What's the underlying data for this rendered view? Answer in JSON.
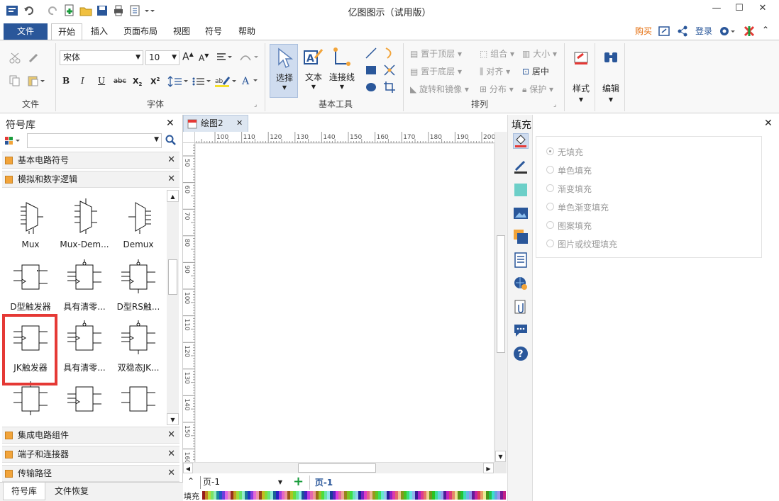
{
  "app": {
    "title": "亿图图示（试用版）"
  },
  "menu": {
    "file": "文件",
    "tabs": [
      "开始",
      "插入",
      "页面布局",
      "视图",
      "符号",
      "帮助"
    ],
    "right": {
      "buy": "购买",
      "login": "登录"
    }
  },
  "ribbon": {
    "font_name": "宋体",
    "font_size": "10",
    "groups": {
      "file": "文件",
      "font": "字体",
      "basic_tools": "基本工具",
      "arrange": "排列"
    },
    "tools": {
      "select": "选择",
      "text": "文本",
      "connector": "连接线"
    },
    "arrange": {
      "bring_front": "置于顶层",
      "send_back": "置于底层",
      "rotate_mirror": "旋转和镜像",
      "group": "组合",
      "align": "对齐",
      "distribute": "分布",
      "size": "大小",
      "center": "居中",
      "protect": "保护"
    },
    "style": "样式",
    "edit": "编辑"
  },
  "library": {
    "title": "符号库",
    "search_placeholder": "",
    "categories": {
      "basic_circuit": "基本电路符号",
      "analog_digital": "模拟和数字逻辑",
      "ic": "集成电路组件",
      "terminals": "端子和连接器",
      "transmission": "传输路径"
    },
    "shapes": [
      {
        "label": "Mux"
      },
      {
        "label": "Mux-Dem..."
      },
      {
        "label": "Demux"
      },
      {
        "label": "D型触发器"
      },
      {
        "label": "具有清零..."
      },
      {
        "label": "D型RS触..."
      },
      {
        "label": "JK触发器"
      },
      {
        "label": "具有清零..."
      },
      {
        "label": "双稳态JK..."
      }
    ],
    "bottom_tabs": {
      "library": "符号库",
      "recovery": "文件恢复"
    }
  },
  "document": {
    "tab": "绘图2",
    "ruler_top": [
      "100",
      "110",
      "120",
      "130",
      "140",
      "150",
      "160",
      "170",
      "180",
      "190",
      "200"
    ],
    "ruler_left": [
      "50",
      "60",
      "70",
      "80",
      "90",
      "100",
      "110",
      "120",
      "130",
      "140",
      "150",
      "160"
    ],
    "page_select": "页-1",
    "page_tab": "页-1",
    "color_label": "填充"
  },
  "fill_panel": {
    "title": "填充",
    "options": [
      "无填充",
      "单色填充",
      "渐变填充",
      "单色渐变填充",
      "图案填充",
      "图片或纹理填充"
    ]
  },
  "colors": {
    "accent": "#2a579a",
    "highlight": "#e53935",
    "buy": "#e46c0a"
  }
}
